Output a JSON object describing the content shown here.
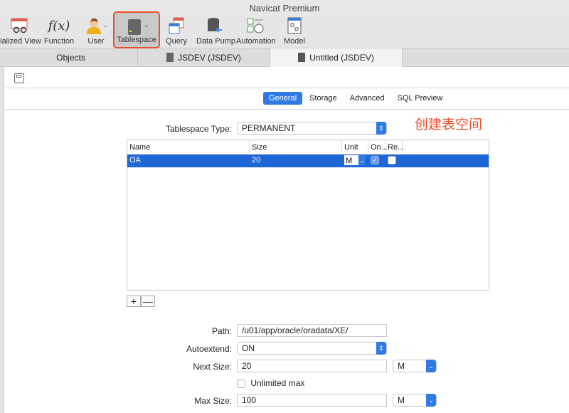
{
  "window_title": "Navicat Premium",
  "toolbar": [
    {
      "label": "ialized View",
      "icon": "materialized-view-icon"
    },
    {
      "label": "Function",
      "icon": "function-icon"
    },
    {
      "label": "User",
      "icon": "user-icon"
    },
    {
      "label": "Tablespace",
      "icon": "tablespace-icon"
    },
    {
      "label": "Query",
      "icon": "query-icon"
    },
    {
      "label": "Data Pump",
      "icon": "data-pump-icon"
    },
    {
      "label": "Automation",
      "icon": "automation-icon"
    },
    {
      "label": "Model",
      "icon": "model-icon"
    }
  ],
  "tabs": [
    "Objects",
    "JSDEV (JSDEV)",
    "Untitled (JSDEV)"
  ],
  "subtabs": [
    "General",
    "Storage",
    "Advanced",
    "SQL Preview"
  ],
  "annotation": "创建表空间",
  "form": {
    "tablespace_type_label": "Tablespace Type:",
    "tablespace_type": "PERMANENT",
    "path_label": "Path:",
    "path": "/u01/app/oracle/oradata/XE/",
    "autoextend_label": "Autoextend:",
    "autoextend": "ON",
    "next_size_label": "Next Size:",
    "next_size": "20",
    "next_unit": "M",
    "unlimited_label": "Unlimited max",
    "unlimited_checked": false,
    "max_size_label": "Max Size:",
    "max_size": "100",
    "max_unit": "M"
  },
  "grid": {
    "headers": [
      "Name",
      "Size",
      "Unit",
      "On...",
      "Re..."
    ],
    "rows": [
      {
        "name": "OA",
        "size": "20",
        "unit": "M",
        "on": true,
        "re": false
      }
    ]
  },
  "add_label": "+",
  "remove_label": "—"
}
